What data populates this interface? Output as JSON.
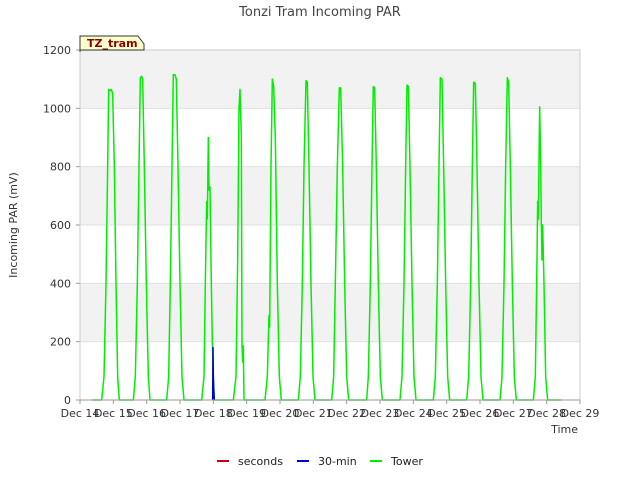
{
  "chart_data": {
    "type": "line",
    "title": "Tonzi Tram Incoming PAR",
    "xlabel": "Time",
    "ylabel": "Incoming PAR (mV)",
    "tag": "TZ_tram",
    "ylim": [
      0,
      1200
    ],
    "xlim": [
      14,
      29
    ],
    "y_ticks": [
      0,
      200,
      400,
      600,
      800,
      1000,
      1200
    ],
    "x_ticks": [
      {
        "value": 14,
        "label": "Dec 14"
      },
      {
        "value": 15,
        "label": "Dec 15"
      },
      {
        "value": 16,
        "label": "Dec 16"
      },
      {
        "value": 17,
        "label": "Dec 17"
      },
      {
        "value": 18,
        "label": "Dec 18"
      },
      {
        "value": 19,
        "label": "Dec 19"
      },
      {
        "value": 20,
        "label": "Dec 20"
      },
      {
        "value": 21,
        "label": "Dec 21"
      },
      {
        "value": 22,
        "label": "Dec 22"
      },
      {
        "value": 23,
        "label": "Dec 23"
      },
      {
        "value": 24,
        "label": "Dec 24"
      },
      {
        "value": 25,
        "label": "Dec 25"
      },
      {
        "value": 26,
        "label": "Dec 26"
      },
      {
        "value": 27,
        "label": "Dec 27"
      },
      {
        "value": 28,
        "label": "Dec 28"
      },
      {
        "value": 29,
        "label": "Dec 29"
      }
    ],
    "grid": true,
    "legend_position": "bottom",
    "series": [
      {
        "name": "seconds",
        "color": "#cc0000",
        "points": []
      },
      {
        "name": "30-min",
        "color": "#0000cc",
        "points": [
          [
            17.98,
            0
          ],
          [
            17.99,
            180
          ],
          [
            18.0,
            80
          ],
          [
            18.01,
            40
          ],
          [
            18.03,
            0
          ]
        ]
      },
      {
        "name": "Tower",
        "color": "#00ee00",
        "points": [
          [
            14.35,
            0
          ],
          [
            14.65,
            0
          ],
          [
            14.72,
            80
          ],
          [
            14.78,
            400
          ],
          [
            14.83,
            800
          ],
          [
            14.86,
            1065
          ],
          [
            14.9,
            1060
          ],
          [
            14.94,
            1065
          ],
          [
            14.98,
            1050
          ],
          [
            15.03,
            800
          ],
          [
            15.08,
            400
          ],
          [
            15.13,
            80
          ],
          [
            15.18,
            0
          ],
          [
            15.6,
            0
          ],
          [
            15.66,
            80
          ],
          [
            15.72,
            400
          ],
          [
            15.77,
            800
          ],
          [
            15.81,
            1105
          ],
          [
            15.85,
            1110
          ],
          [
            15.88,
            1100
          ],
          [
            15.93,
            800
          ],
          [
            15.99,
            400
          ],
          [
            16.05,
            80
          ],
          [
            16.1,
            0
          ],
          [
            16.6,
            0
          ],
          [
            16.66,
            80
          ],
          [
            16.71,
            400
          ],
          [
            16.76,
            800
          ],
          [
            16.8,
            1115
          ],
          [
            16.85,
            1115
          ],
          [
            16.89,
            1100
          ],
          [
            16.94,
            800
          ],
          [
            17.0,
            400
          ],
          [
            17.06,
            80
          ],
          [
            17.12,
            0
          ],
          [
            17.65,
            0
          ],
          [
            17.72,
            80
          ],
          [
            17.76,
            400
          ],
          [
            17.8,
            680
          ],
          [
            17.82,
            620
          ],
          [
            17.85,
            900
          ],
          [
            17.87,
            720
          ],
          [
            17.9,
            730
          ],
          [
            17.94,
            400
          ],
          [
            17.97,
            200
          ],
          [
            18.0,
            80
          ],
          [
            18.03,
            0
          ],
          [
            18.6,
            0
          ],
          [
            18.68,
            80
          ],
          [
            18.73,
            480
          ],
          [
            18.77,
            1000
          ],
          [
            18.8,
            1065
          ],
          [
            18.84,
            900
          ],
          [
            18.86,
            190
          ],
          [
            18.88,
            130
          ],
          [
            18.9,
            185
          ],
          [
            18.92,
            0
          ],
          [
            19.55,
            0
          ],
          [
            19.62,
            80
          ],
          [
            19.67,
            290
          ],
          [
            19.69,
            250
          ],
          [
            19.73,
            800
          ],
          [
            19.77,
            1100
          ],
          [
            19.81,
            1075
          ],
          [
            19.86,
            900
          ],
          [
            19.92,
            400
          ],
          [
            19.98,
            80
          ],
          [
            20.04,
            0
          ],
          [
            20.55,
            0
          ],
          [
            20.61,
            80
          ],
          [
            20.67,
            400
          ],
          [
            20.72,
            800
          ],
          [
            20.78,
            1095
          ],
          [
            20.82,
            1090
          ],
          [
            20.87,
            800
          ],
          [
            20.93,
            400
          ],
          [
            20.99,
            80
          ],
          [
            21.05,
            0
          ],
          [
            21.55,
            0
          ],
          [
            21.61,
            80
          ],
          [
            21.66,
            400
          ],
          [
            21.72,
            800
          ],
          [
            21.78,
            1070
          ],
          [
            21.82,
            1070
          ],
          [
            21.88,
            800
          ],
          [
            21.94,
            400
          ],
          [
            22.0,
            80
          ],
          [
            22.06,
            0
          ],
          [
            22.6,
            0
          ],
          [
            22.65,
            80
          ],
          [
            22.71,
            400
          ],
          [
            22.76,
            800
          ],
          [
            22.8,
            1075
          ],
          [
            22.84,
            1070
          ],
          [
            22.89,
            800
          ],
          [
            22.95,
            400
          ],
          [
            23.01,
            80
          ],
          [
            23.07,
            0
          ],
          [
            23.6,
            0
          ],
          [
            23.66,
            80
          ],
          [
            23.72,
            400
          ],
          [
            23.77,
            800
          ],
          [
            23.81,
            1080
          ],
          [
            23.85,
            1075
          ],
          [
            23.9,
            800
          ],
          [
            23.96,
            400
          ],
          [
            24.02,
            80
          ],
          [
            24.08,
            0
          ],
          [
            24.6,
            0
          ],
          [
            24.66,
            80
          ],
          [
            24.72,
            400
          ],
          [
            24.77,
            800
          ],
          [
            24.81,
            1105
          ],
          [
            24.86,
            1100
          ],
          [
            24.91,
            800
          ],
          [
            24.97,
            400
          ],
          [
            25.03,
            80
          ],
          [
            25.09,
            0
          ],
          [
            25.6,
            0
          ],
          [
            25.66,
            80
          ],
          [
            25.72,
            400
          ],
          [
            25.77,
            800
          ],
          [
            25.81,
            1090
          ],
          [
            25.86,
            1085
          ],
          [
            25.91,
            800
          ],
          [
            25.97,
            400
          ],
          [
            26.03,
            80
          ],
          [
            26.09,
            0
          ],
          [
            26.6,
            0
          ],
          [
            26.66,
            80
          ],
          [
            26.72,
            400
          ],
          [
            26.77,
            800
          ],
          [
            26.82,
            1105
          ],
          [
            26.86,
            1090
          ],
          [
            26.91,
            800
          ],
          [
            26.97,
            400
          ],
          [
            27.03,
            80
          ],
          [
            27.09,
            0
          ],
          [
            27.6,
            0
          ],
          [
            27.66,
            80
          ],
          [
            27.7,
            400
          ],
          [
            27.73,
            680
          ],
          [
            27.75,
            620
          ],
          [
            27.79,
            1005
          ],
          [
            27.82,
            820
          ],
          [
            27.84,
            600
          ],
          [
            27.86,
            480
          ],
          [
            27.88,
            600
          ],
          [
            27.92,
            400
          ],
          [
            27.97,
            80
          ],
          [
            28.03,
            0
          ],
          [
            28.45,
            0
          ]
        ]
      }
    ]
  }
}
